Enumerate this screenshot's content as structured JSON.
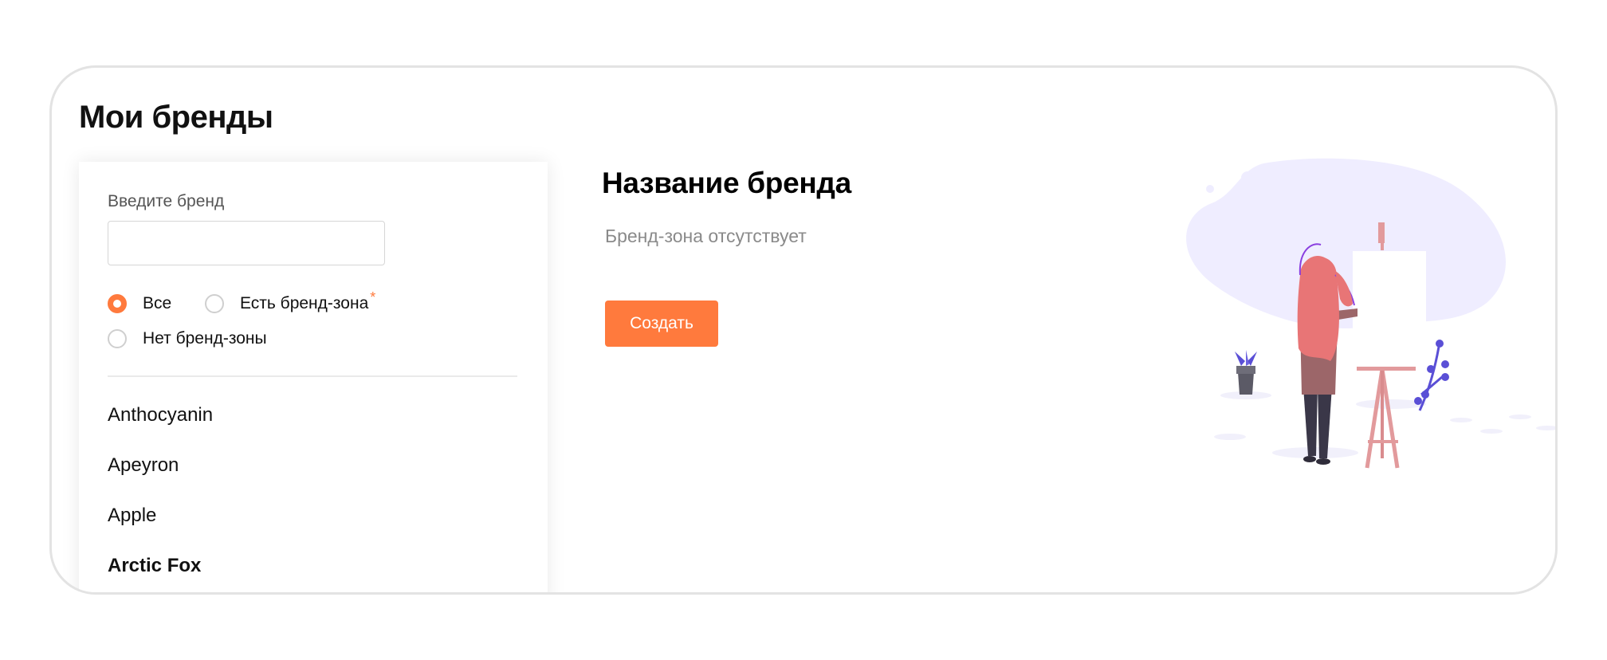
{
  "page": {
    "title": "Мои бренды"
  },
  "filter": {
    "search_label": "Введите бренд",
    "search_value": "",
    "search_placeholder": "",
    "radio_all": "Все",
    "radio_has_zone": "Есть бренд-зона",
    "radio_has_zone_marker": "*",
    "radio_no_zone": "Нет бренд-зоны",
    "selected": "all"
  },
  "brands": [
    "Anthocyanin",
    "Apeyron",
    "Apple",
    "Arctic Fox"
  ],
  "detail": {
    "title": "Название бренда",
    "status": "Бренд-зона отсутствует",
    "create_label": "Создать"
  },
  "colors": {
    "accent": "#ff7a3d",
    "blob": "#efedff",
    "hair": "#e87576",
    "plant": "#5a4fd6"
  },
  "illustration": {
    "name": "woman-painting-at-easel"
  }
}
